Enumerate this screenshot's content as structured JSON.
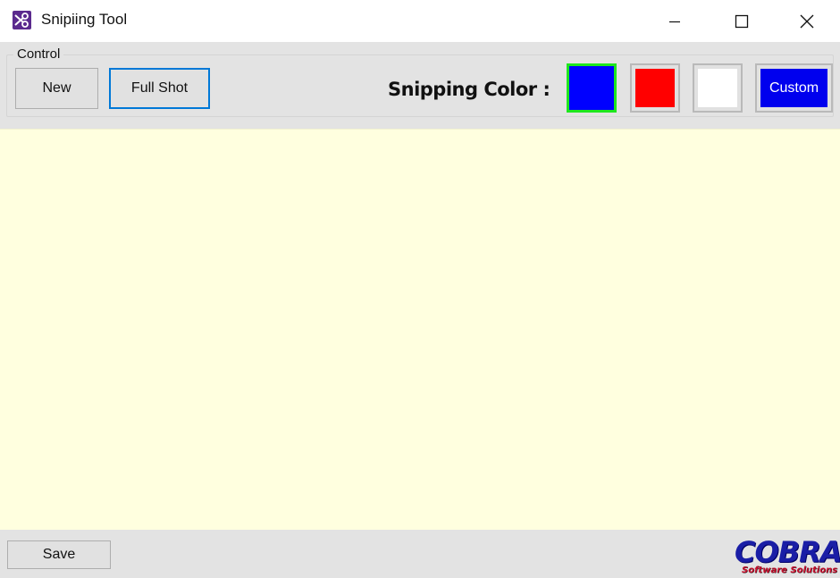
{
  "window": {
    "title": "Snipiing Tool",
    "icon": "scissors-icon",
    "controls": {
      "minimize": "minimize-icon",
      "maximize": "maximize-icon",
      "close": "close-icon"
    }
  },
  "toolbar": {
    "group_label": "Control",
    "new_label": "New",
    "full_shot_label": "Full Shot",
    "snipping_color_label": "Snipping Color :",
    "colors": [
      {
        "name": "blue",
        "value": "#0000ff",
        "selected": true
      },
      {
        "name": "red",
        "value": "#ff0000",
        "selected": false
      },
      {
        "name": "white",
        "value": "#ffffff",
        "selected": false
      }
    ],
    "custom_label": "Custom",
    "custom_color": "#0000ee",
    "selected_border_color": "#1ee71e"
  },
  "canvas": {
    "background": "#ffffdf"
  },
  "footer": {
    "save_label": "Save",
    "logo_main": "COBRA",
    "logo_sub": "Software Solutions"
  }
}
